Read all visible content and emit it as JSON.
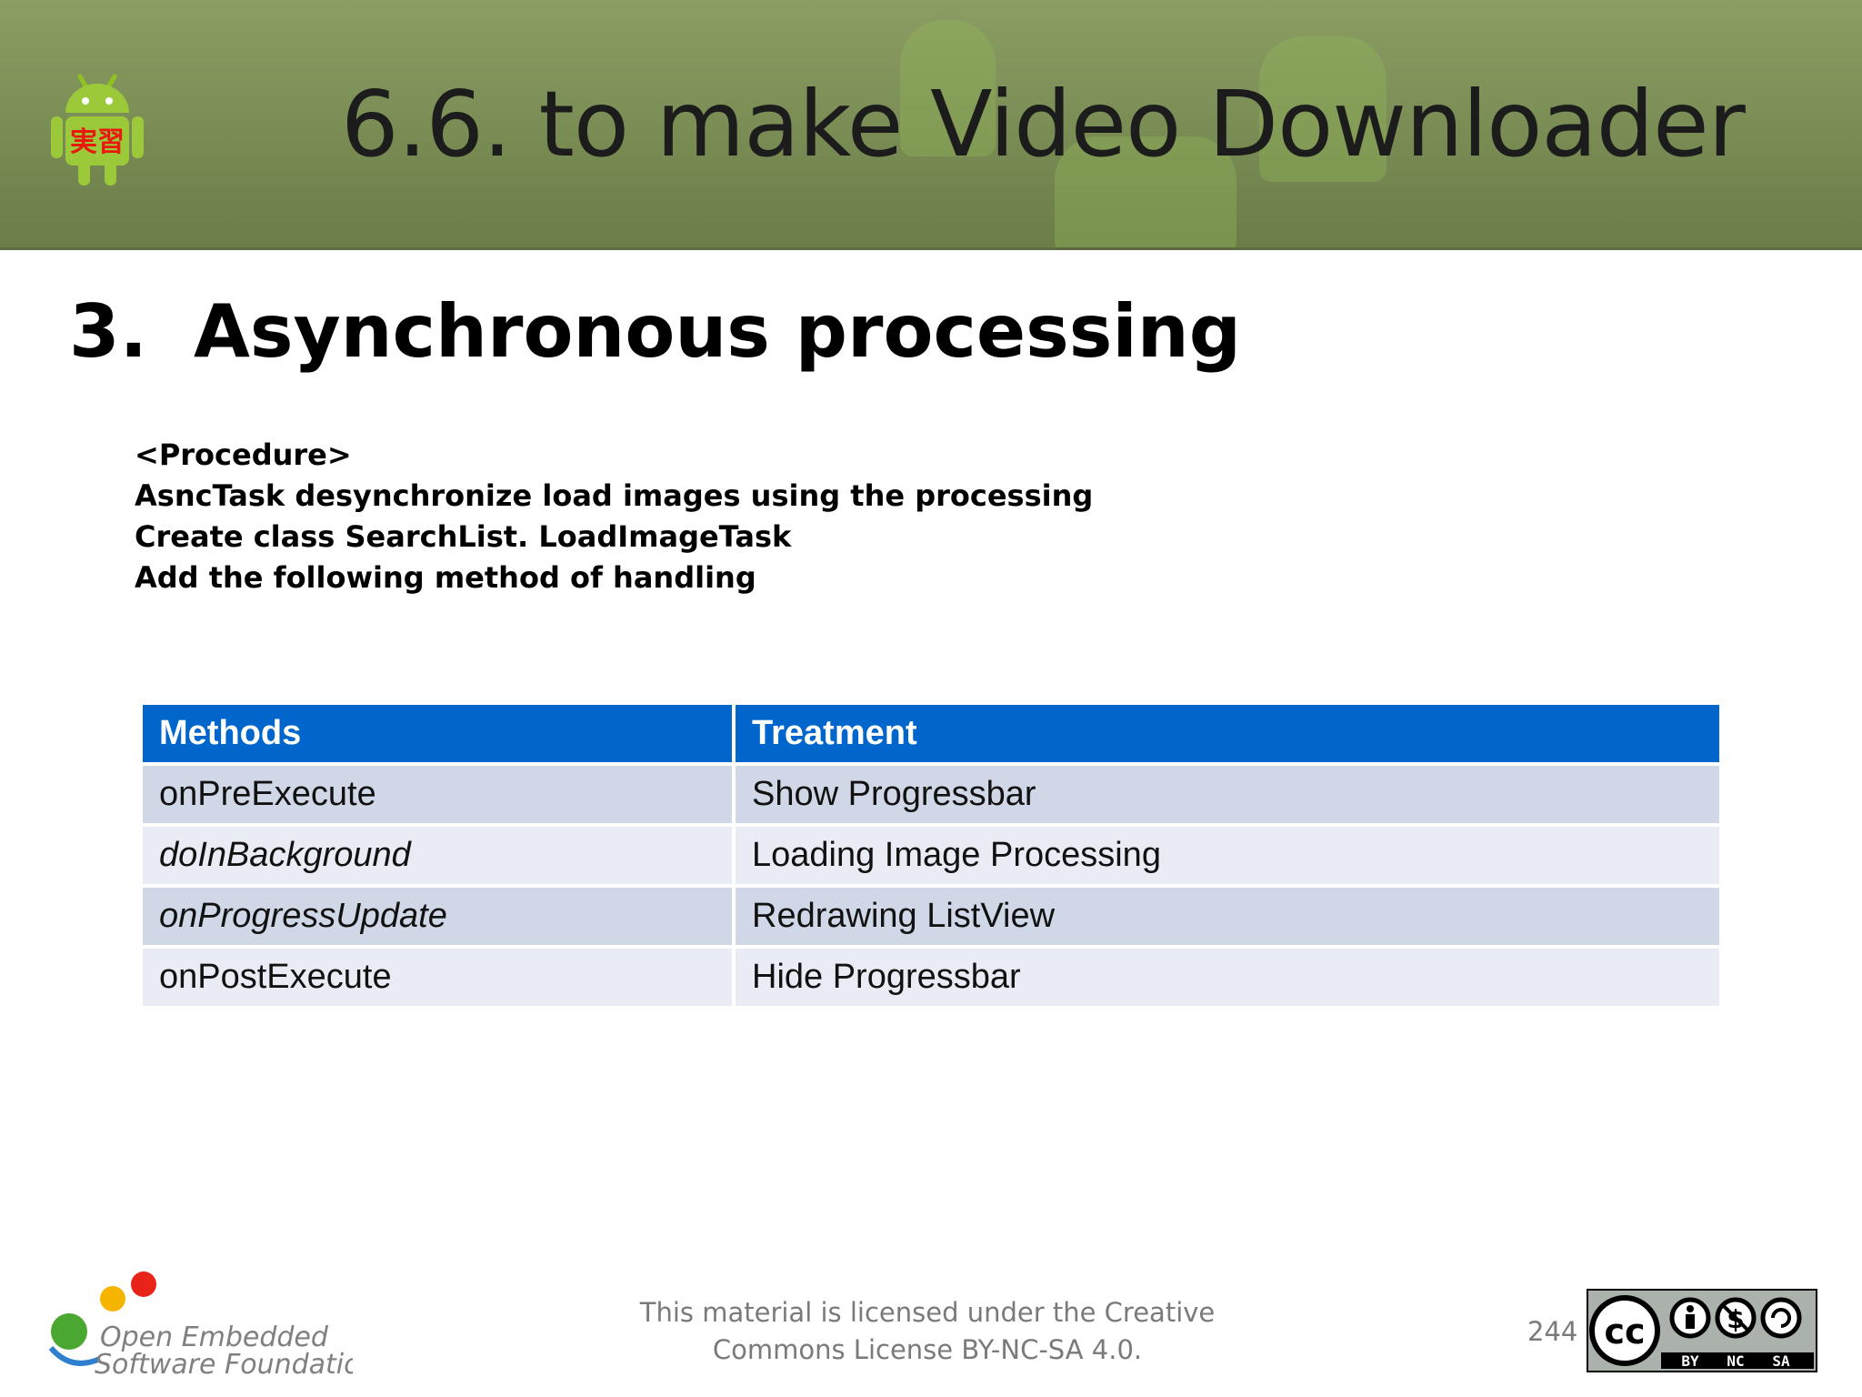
{
  "header": {
    "title": "6.6. to make Video Downloader",
    "logo_text": "実習"
  },
  "section": {
    "number": "3.",
    "heading": "Asynchronous processing"
  },
  "procedure": {
    "lines": [
      "<Procedure>",
      "AsncTask desynchronize load images using the processing",
      "Create class SearchList. LoadImageTask",
      "Add the following method of handling"
    ]
  },
  "table": {
    "headers": [
      "Methods",
      "Treatment"
    ],
    "rows": [
      [
        "onPreExecute",
        "Show Progressbar"
      ],
      [
        "doInBackground",
        "Loading Image Processing"
      ],
      [
        "onProgressUpdate",
        "Redrawing ListView"
      ],
      [
        "onPostExecute",
        "Hide Progressbar"
      ]
    ]
  },
  "footer": {
    "license_line1": "This material is licensed under the Creative",
    "license_line2": "Commons License BY-NC-SA 4.0.",
    "page_number": "244",
    "org_logo_line1": "Open Embedded",
    "org_logo_line2": "Software Foundation",
    "cc_labels": [
      "cc",
      "BY",
      "NC",
      "SA"
    ]
  },
  "colors": {
    "table_header": "#0066cc",
    "row_odd": "#d0d8e8",
    "row_even": "#e9ecf4",
    "header_band": "#7e9158"
  }
}
